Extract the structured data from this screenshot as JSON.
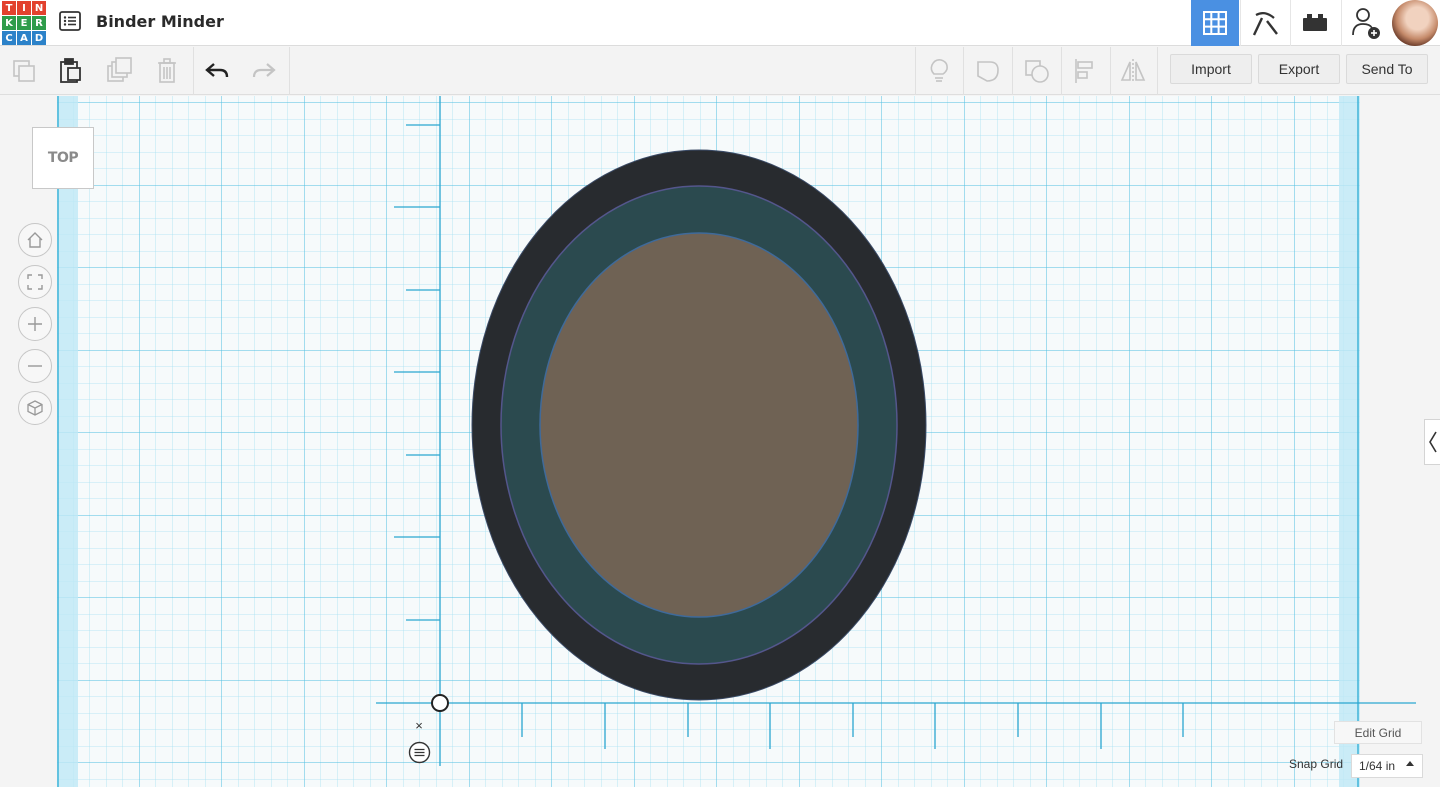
{
  "app": {
    "logo_letters": [
      "T",
      "I",
      "N",
      "K",
      "E",
      "R",
      "C",
      "A",
      "D"
    ],
    "logo_colors": [
      "#e2412e",
      "#e2412e",
      "#e2412e",
      "#2e9c4a",
      "#2e9c4a",
      "#2e9c4a",
      "#2c82c9",
      "#2c82c9",
      "#2c82c9"
    ],
    "design_title": "Binder Minder"
  },
  "topnav": {
    "items": [
      {
        "icon": "3d-grid-icon",
        "active": true
      },
      {
        "icon": "pickaxe-icon",
        "active": false
      },
      {
        "icon": "bricks-icon",
        "active": false
      },
      {
        "icon": "add-user-icon",
        "active": false
      }
    ],
    "accent_color": "#4a90e2"
  },
  "toolbar": {
    "left_icons": [
      "copy-icon",
      "paste-icon",
      "duplicate-icon",
      "delete-icon",
      "undo-icon",
      "redo-icon"
    ],
    "right_icons": [
      "lightbulb-icon",
      "group-icon",
      "ungroup-icon",
      "align-icon",
      "mirror-icon"
    ],
    "import_label": "Import",
    "export_label": "Export",
    "send_to_label": "Send To"
  },
  "workplane": {
    "view_label": "TOP",
    "controls": [
      "home-icon",
      "fit-view-icon",
      "zoom-in-icon",
      "zoom-out-icon",
      "ortho-cube-icon"
    ],
    "grid_color": "#3fb3d8",
    "shape_colors": {
      "outer_ring": "#282b2f",
      "middle_ring": "#2b4a4f",
      "inner_fill": "#6f6254"
    },
    "ruler_close_label": "×",
    "edit_grid_label": "Edit Grid",
    "snap_grid_label": "Snap Grid",
    "snap_grid_value": "1/64 in"
  }
}
